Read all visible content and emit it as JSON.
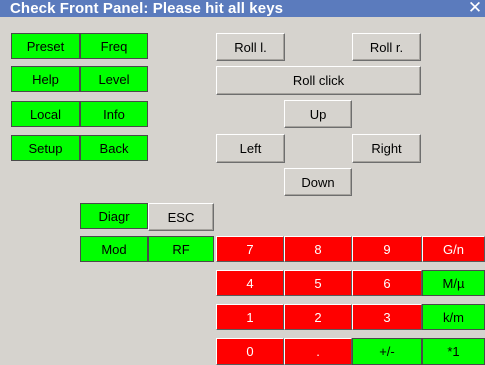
{
  "window": {
    "title": "Check Front Panel: Please hit all keys",
    "close_icon": "close-icon"
  },
  "colors": {
    "title_bar": "#5b7bbd",
    "background": "#d6d3ce",
    "key_pressed": "#00ff00",
    "key_not_pressed": "#ff0000",
    "key_neutral": "#d6d3ce"
  },
  "keys": {
    "preset": "Preset",
    "freq": "Freq",
    "help": "Help",
    "level": "Level",
    "local": "Local",
    "info": "Info",
    "setup": "Setup",
    "back": "Back",
    "diagr": "Diagr",
    "esc": "ESC",
    "mod": "Mod",
    "rf": "RF",
    "roll_l": "Roll l.",
    "roll_r": "Roll r.",
    "roll_click": "Roll click",
    "up": "Up",
    "left": "Left",
    "right": "Right",
    "down": "Down",
    "n7": "7",
    "n8": "8",
    "n9": "9",
    "unit_g_n": "G/n",
    "n4": "4",
    "n5": "5",
    "n6": "6",
    "unit_m_u": "M/µ",
    "n1": "1",
    "n2": "2",
    "n3": "3",
    "unit_k_m": "k/m",
    "n0": "0",
    "dot": ".",
    "plus_minus": "+/-",
    "unit_x1": "*1"
  }
}
